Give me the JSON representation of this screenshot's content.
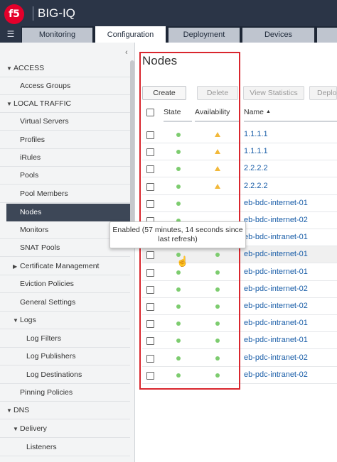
{
  "app": {
    "logo": "f5",
    "title": "BIG-IQ"
  },
  "tabs": [
    "Monitoring",
    "Configuration",
    "Deployment",
    "Devices"
  ],
  "sidebar": {
    "items": [
      {
        "label": "ACCESS"
      },
      {
        "label": "Access Groups"
      },
      {
        "label": "LOCAL TRAFFIC"
      },
      {
        "label": "Virtual Servers"
      },
      {
        "label": "Profiles"
      },
      {
        "label": "iRules"
      },
      {
        "label": "Pools"
      },
      {
        "label": "Pool Members"
      },
      {
        "label": "Nodes"
      },
      {
        "label": "Monitors"
      },
      {
        "label": "SNAT Pools"
      },
      {
        "label": "Certificate Management"
      },
      {
        "label": "Eviction Policies"
      },
      {
        "label": "General Settings"
      },
      {
        "label": "Logs"
      },
      {
        "label": "Log Filters"
      },
      {
        "label": "Log Publishers"
      },
      {
        "label": "Log Destinations"
      },
      {
        "label": "Pinning Policies"
      },
      {
        "label": "DNS"
      },
      {
        "label": "Delivery"
      },
      {
        "label": "Listeners"
      }
    ]
  },
  "main": {
    "title": "Nodes",
    "buttons": {
      "create": "Create",
      "delete": "Delete",
      "view_statistics": "View Statistics",
      "deploy": "Deplo"
    },
    "columns": {
      "state": "State",
      "availability": "Availability",
      "name": "Name"
    },
    "rows": [
      {
        "name": "1.1.1.1",
        "availability": "warning"
      },
      {
        "name": "1.1.1.1",
        "availability": "warning"
      },
      {
        "name": "2.2.2.2",
        "availability": "warning"
      },
      {
        "name": "2.2.2.2",
        "availability": "warning"
      },
      {
        "name": "eb-bdc-internet-01",
        "availability": "unknown"
      },
      {
        "name": "eb-bdc-internet-02",
        "availability": "unknown"
      },
      {
        "name": "eb-bdc-intranet-01",
        "availability": "unknown"
      },
      {
        "name": "eb-pdc-internet-01",
        "availability": "available"
      },
      {
        "name": "eb-pdc-internet-01",
        "availability": "available"
      },
      {
        "name": "eb-pdc-internet-02",
        "availability": "available"
      },
      {
        "name": "eb-pdc-internet-02",
        "availability": "available"
      },
      {
        "name": "eb-pdc-intranet-01",
        "availability": "available"
      },
      {
        "name": "eb-pdc-intranet-01",
        "availability": "available"
      },
      {
        "name": "eb-pdc-intranet-02",
        "availability": "available"
      },
      {
        "name": "eb-pdc-intranet-02",
        "availability": "available"
      }
    ]
  },
  "tooltip": {
    "text": "Enabled (57 minutes, 14 seconds since last refresh)"
  },
  "colors": {
    "header": "#2b3547",
    "accent_red": "#d9262e",
    "status_green": "#7dcc6f",
    "status_warning": "#f2b93b",
    "link": "#1a5ea8"
  }
}
